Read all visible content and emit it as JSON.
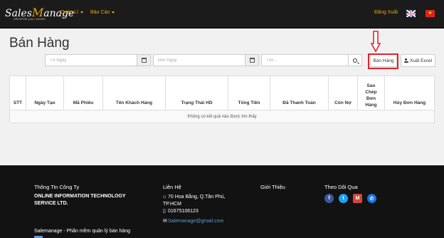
{
  "nav": {
    "logo_main": "Sales",
    "logo_m": "M",
    "logo_rest": "anage",
    "logo_tagline": "GROWTH your SALES",
    "menu": [
      {
        "label": "Quản Lí"
      },
      {
        "label": "Báo Cáo"
      }
    ],
    "logout": "Đăng Xuất",
    "flag_vn_star": "★"
  },
  "page": {
    "title": "Bán Hàng"
  },
  "filters": {
    "from_date_placeholder": "Từ Ngày",
    "to_date_placeholder": "Đến Ngày",
    "search_placeholder": "Tìm..."
  },
  "buttons": {
    "sale": "Bán Hàng",
    "export_excel": "Xuất Excel"
  },
  "table": {
    "columns": [
      "STT",
      "Ngày Tạo",
      "Mã Phiếu",
      "Tên Khách Hàng",
      "Trạng Thái HD",
      "Tổng Tiền",
      "Đã Thanh Toán",
      "Còn Nợ",
      "Sao Chép Đơn Hàng",
      "Hủy Đơn Hàng"
    ],
    "empty_message": "Không có kết quả nào được tìm thấy"
  },
  "footer": {
    "company_heading": "Thông Tin Công Ty",
    "company_name": "ONLINE INFORMATION TECHNOLOGY SERVICE LTD.",
    "tagline": "Salemanage - Phần mềm quản lý bán hàng",
    "contact_heading": "Liên Hệ",
    "address": "70 Hoa Bằng, Q.Tân Phú, TP.HCM",
    "phone": "01675106123",
    "email": "Salemanage@gmail.com",
    "intro_heading": "Giới Thiệu",
    "follow_heading": "Theo Dõi Qua",
    "social": [
      {
        "icon": "facebook-icon",
        "glyph": "f",
        "color": "#3b5998"
      },
      {
        "icon": "twitter-icon",
        "glyph": "t",
        "color": "#1da1f2"
      },
      {
        "icon": "gmail-icon",
        "glyph": "M",
        "color": "#d44638"
      },
      {
        "icon": "phone-icon",
        "glyph": "✆",
        "color": "#1a73e8"
      }
    ]
  }
}
